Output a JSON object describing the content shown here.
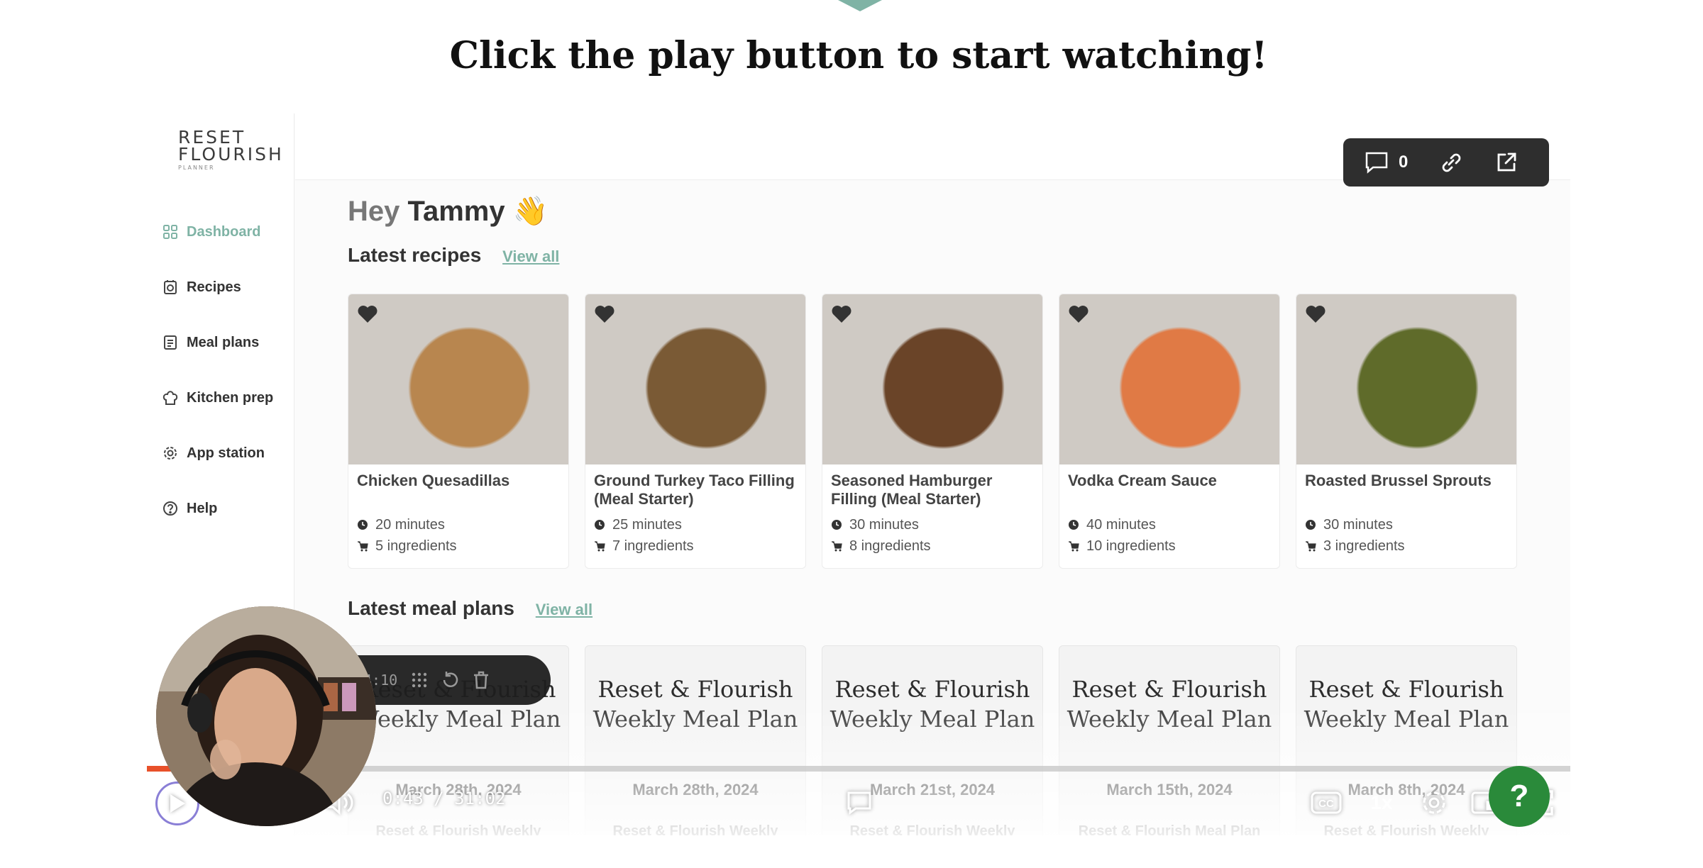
{
  "headline": "Click the play button to start watching!",
  "app": {
    "logo": {
      "line1": "RESET",
      "line2": "FLOURISH",
      "line3": "PLANNER"
    },
    "nav": [
      {
        "label": "Dashboard",
        "icon": "grid-icon",
        "active": true
      },
      {
        "label": "Recipes",
        "icon": "recipe-icon",
        "active": false
      },
      {
        "label": "Meal plans",
        "icon": "meal-plan-icon",
        "active": false
      },
      {
        "label": "Kitchen prep",
        "icon": "chef-hat-icon",
        "active": false
      },
      {
        "label": "App station",
        "icon": "gear-icon",
        "active": false
      },
      {
        "label": "Help",
        "icon": "help-icon",
        "active": false
      }
    ],
    "greeting": {
      "hey": "Hey",
      "name": "Tammy",
      "emoji": "👋"
    },
    "recipes_section": {
      "title": "Latest recipes",
      "view_all": "View all"
    },
    "recipes": [
      {
        "title": "Chicken Quesadillas",
        "time": "20 minutes",
        "ingredients": "5 ingredients",
        "img_color": "#b8864f"
      },
      {
        "title": "Ground Turkey Taco Filling (Meal Starter)",
        "time": "25 minutes",
        "ingredients": "7 ingredients",
        "img_color": "#7a5a35"
      },
      {
        "title": "Seasoned Hamburger Filling (Meal Starter)",
        "time": "30 minutes",
        "ingredients": "8 ingredients",
        "img_color": "#6a4428"
      },
      {
        "title": "Vodka Cream Sauce",
        "time": "40 minutes",
        "ingredients": "10 ingredients",
        "img_color": "#e07a45"
      },
      {
        "title": "Roasted Brussel Sprouts",
        "time": "30 minutes",
        "ingredients": "3 ingredients",
        "img_color": "#5f6b2a"
      }
    ],
    "meal_plans_section": {
      "title": "Latest meal plans",
      "view_all": "View all"
    },
    "meal_plans": [
      {
        "title_line1": "Reset & Flourish",
        "title_line2": "Weekly Meal Plan",
        "date": "March 28th, 2024",
        "sub": "Reset & Flourish Weekly"
      },
      {
        "title_line1": "Reset & Flourish",
        "title_line2": "Weekly Meal Plan",
        "date": "March 28th, 2024",
        "sub": "Reset & Flourish Weekly"
      },
      {
        "title_line1": "Reset & Flourish",
        "title_line2": "Weekly Meal Plan",
        "date": "March 21st, 2024",
        "sub": "Reset & Flourish Weekly"
      },
      {
        "title_line1": "Reset & Flourish",
        "title_line2": "Weekly Meal Plan",
        "date": "March 15th, 2024",
        "sub": "Reset & Flourish Meal Plan"
      },
      {
        "title_line1": "Reset & Flourish",
        "title_line2": "Weekly Meal Plan",
        "date": "March 8th, 2024",
        "sub": "Reset & Flourish Weekly"
      }
    ]
  },
  "share": {
    "comment_count": "0"
  },
  "player": {
    "current_time": "0:43",
    "duration": "31:02",
    "time_display": "0:43 / 31:02",
    "played_fraction": 0.023,
    "buffered_fraction": 0.058,
    "skip_back": "5",
    "skip_forward": "5",
    "speed": "1x",
    "recorder_time": "4:10",
    "colors": {
      "progress": "#e8502a",
      "accent": "#7fb3a5"
    }
  },
  "help_bubble": "?"
}
